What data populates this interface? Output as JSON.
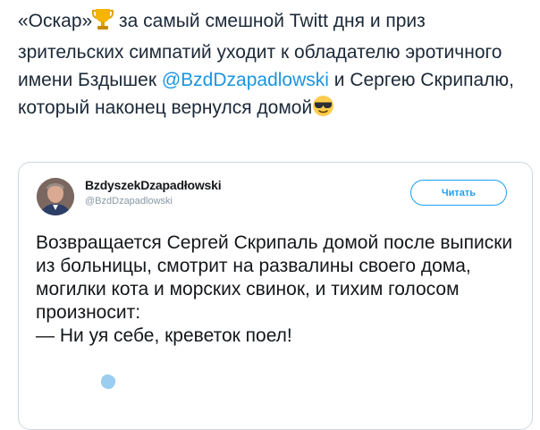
{
  "tweet": {
    "text_part1": "«Оскар»",
    "text_part2": " за самый смешной Twitt дня и приз зрительских симпатий уходит к обладателю эротичного имени Бздышек ",
    "mention": "@BzdDzapadlowski",
    "text_part3": " и Сергею Скрипалю, который наконец вернулся домой",
    "emoji_trophy": "trophy-icon",
    "emoji_sunglasses": "sunglasses-face-icon"
  },
  "quoted": {
    "display_name": "BzdyszekDzapadłowski",
    "handle": "@BzdDzapadlowski",
    "follow_label": "Читать",
    "text": "Возвращается Сергей Скрипаль домой после выписки из больницы, смотрит на развалины своего дома, могилки кота и морских свинок, и тихим голосом произносит:\n— Ни  уя себе, креветок поел!"
  },
  "colors": {
    "link": "#1b95e0",
    "follow": "#1da1f2",
    "card_border": "#cdd7e0",
    "text": "#14171a"
  }
}
